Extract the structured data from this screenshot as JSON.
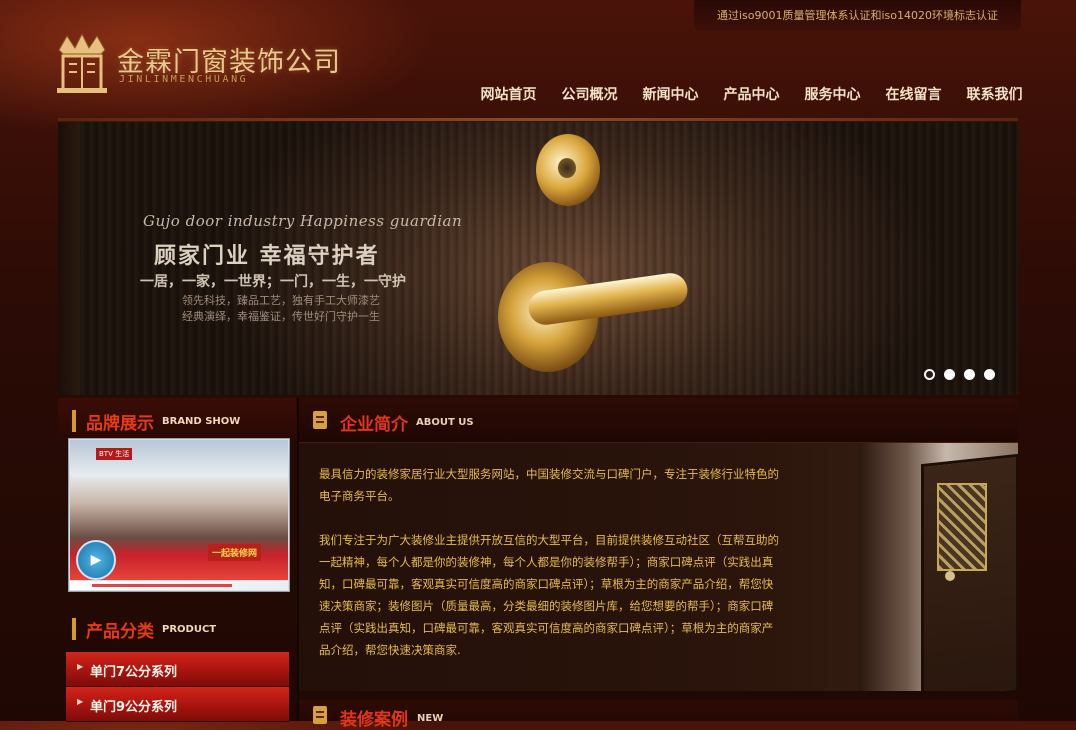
{
  "header": {
    "certification": "通过iso9001质量管理体系认证和iso14020环境标志认证",
    "logo_title": "金霖门窗装饰公司",
    "logo_subtitle": "JINLINMENCHUANG"
  },
  "nav": {
    "items": [
      {
        "label": "网站首页"
      },
      {
        "label": "公司概况"
      },
      {
        "label": "新闻中心"
      },
      {
        "label": "产品中心"
      },
      {
        "label": "服务中心"
      },
      {
        "label": "在线留言"
      },
      {
        "label": "联系我们"
      }
    ]
  },
  "banner": {
    "english_tagline": "Gujo door industry   Happiness guardian",
    "slogan": "顾家门业  幸福守护者",
    "tagline": "一居，一家，一世界；一门，一生，一守护",
    "line1": "领先科技，臻品工艺，独有手工大师漆艺",
    "line2": "经典演绎，幸福鉴证，传世好门守护一生",
    "slide_count": 4,
    "active_slide": 1
  },
  "brand": {
    "title": "品牌展示",
    "title_en": "BRAND SHOW",
    "video_logo": "BTV 生活",
    "video_caption": "一起装修网"
  },
  "categories": {
    "title": "产品分类",
    "title_en": "PRODUCT",
    "items": [
      {
        "label": "单门7公分系列"
      },
      {
        "label": "单门9公分系列"
      }
    ]
  },
  "about": {
    "title": "企业简介",
    "title_en": "ABOUT US",
    "paragraph1": "最具信力的装修家居行业大型服务网站，中国装修交流与口碑门户，专注于装修行业特色的电子商务平台。",
    "paragraph2": "我们专注于为广大装修业主提供开放互信的大型平台，目前提供装修互动社区（互帮互助的一起精神，每个人都是你的装修神，每个人都是你的装修帮手）；商家口碑点评（实践出真知，口碑最可靠，客观真实可信度高的商家口碑点评）；草根为主的商家产品介绍，帮您快速决策商家；装修图片（质量最高，分类最细的装修图片库，给您想要的帮手）；商家口碑点评（实践出真知，口碑最可靠，客观真实可信度高的商家口碑点评）；草根为主的商家产品介绍，帮您快速决策商家."
  },
  "cases": {
    "title": "装修案例",
    "title_en": "NEW"
  },
  "colors": {
    "accent_red": "#e2361a",
    "gold_text": "#e6bc4c",
    "background": "#2a0b05"
  }
}
